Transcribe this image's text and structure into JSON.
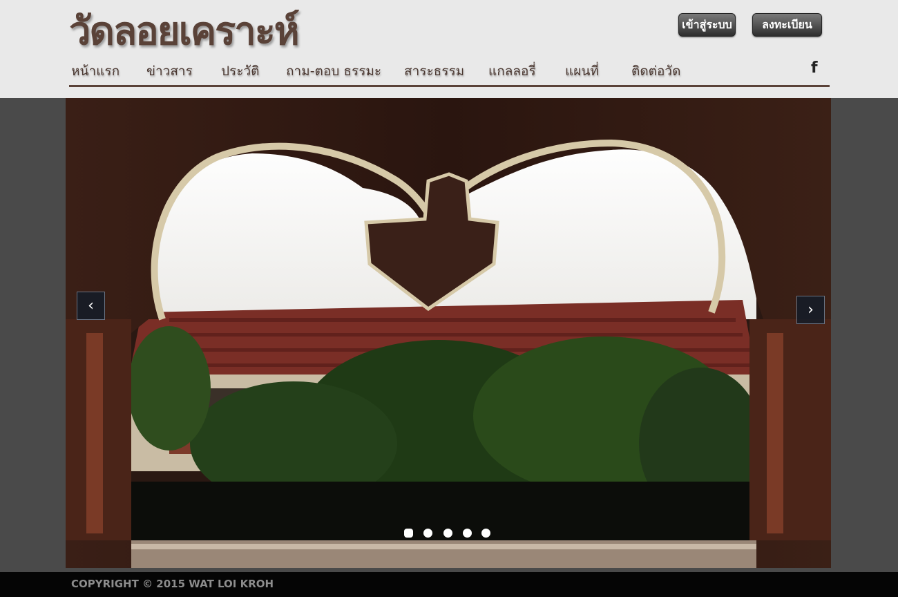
{
  "header": {
    "logo": "วัดลอยเคราะห์",
    "login_label": "เข้าสู่ระบบ",
    "register_label": "ลงทะเบียน"
  },
  "nav": {
    "items": [
      {
        "label": "หน้าแรก"
      },
      {
        "label": "ข่าวสาร"
      },
      {
        "label": "ประวัติ"
      },
      {
        "label": "ถาม-ตอบ ธรรมะ"
      },
      {
        "label": "สาระธรรม"
      },
      {
        "label": "แกลลอรี่"
      },
      {
        "label": "แผนที่"
      },
      {
        "label": "ติดต่อวัด"
      }
    ],
    "facebook_glyph": "f"
  },
  "slider": {
    "prev_glyph": "‹",
    "next_glyph": "›",
    "slide_count": 5,
    "active_slide": 1
  },
  "footer": {
    "copyright": "COPYRIGHT © 2015 WAT LOI KROH"
  },
  "colors": {
    "header_bg": "#e9e9e9",
    "brand_brown": "#5a4238",
    "page_bg": "#4a4a4a",
    "footer_bg": "#050505"
  },
  "icons": {
    "facebook": "facebook-icon",
    "prev": "chevron-left-icon",
    "next": "chevron-right-icon"
  }
}
